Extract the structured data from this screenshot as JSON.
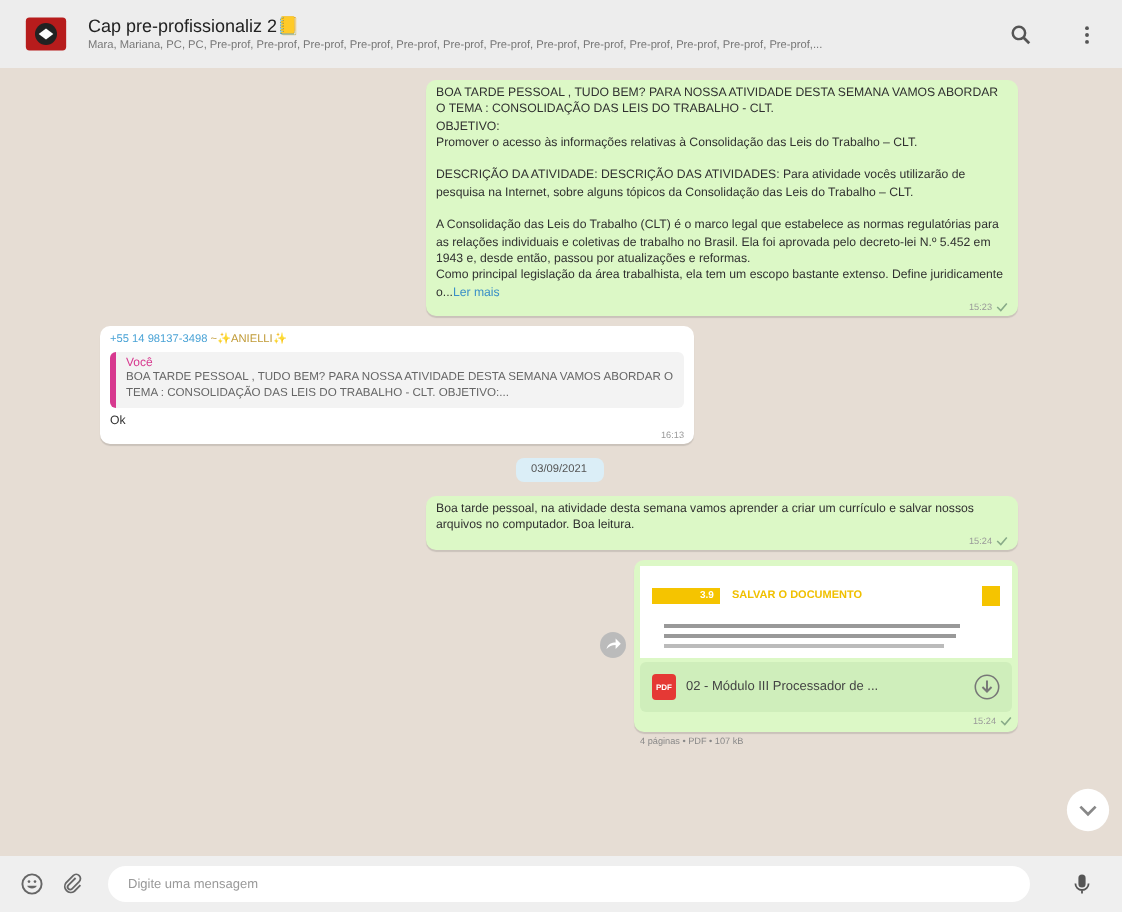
{
  "header": {
    "title": "Cap pre-profissionaliz 2",
    "title_emoji": "📒",
    "members": "Mara, Mariana, PC, PC, Pre-prof, Pre-prof, Pre-prof, Pre-prof, Pre-prof, Pre-prof, Pre-prof, Pre-prof, Pre-prof, Pre-prof, Pre-prof, Pre-prof, Pre-prof,..."
  },
  "messages": [
    {
      "kind": "text",
      "outgoing": true,
      "text": "BOA TARDE PESSOAL , TUDO BEM? PARA NOSSA ATIVIDADE DESTA SEMANA VAMOS ABORDAR O TEMA : CONSOLIDAÇÃO DAS LEIS DO TRABALHO - CLT.\nOBJETIVO:\nPromover o acesso às informações relativas à Consolidação das Leis do Trabalho – CLT.\n\nDESCRIÇÃO DA ATIVIDADE: DESCRIÇÃO DAS ATIVIDADES: Para atividade vocês utilizarão de pesquisa na Internet, sobre alguns tópicos da Consolidação das Leis do Trabalho – CLT.\n\n A Consolidação das Leis do Trabalho (CLT) é o marco legal que estabelece as normas regulatórias para as relações individuais e coletivas de trabalho no Brasil. Ela foi aprovada pelo decreto-lei N.º 5.452 em 1943 e, desde então, passou por atualizações e reformas.\nComo principal legislação da área trabalhista, ela tem um escopo bastante extenso. Define juridicamente o...",
      "read_more": "Ler mais",
      "time": "15:23"
    },
    {
      "kind": "reply",
      "outgoing": false,
      "sender_phone": "+55 14 98137-3498",
      "sender_name": "~✨ANIELLI✨",
      "quote_author": "Você",
      "quote_text": "BOA TARDE PESSOAL , TUDO BEM? PARA NOSSA ATIVIDADE DESTA SEMANA VAMOS ABORDAR O TEMA : CONSOLIDAÇÃO DAS LEIS DO TRABALHO - CLT. OBJETIVO:...",
      "text": "Ok",
      "time": "16:13"
    },
    {
      "kind": "date",
      "text": "03/09/2021"
    },
    {
      "kind": "text",
      "outgoing": true,
      "text": "Boa tarde pessoal, na atividade desta semana vamos aprender a criar um currículo e salvar nossos arquivos no computador. Boa leitura.",
      "time": "15:24"
    },
    {
      "kind": "document",
      "outgoing": true,
      "preview_number": "3.9",
      "preview_heading": "SALVAR O DOCUMENTO",
      "file_type": "PDF",
      "file_name": "02 - Módulo III Processador de ...",
      "meta": "4 páginas • PDF • 107 kB",
      "time": "15:24"
    }
  ],
  "composer": {
    "placeholder": "Digite uma mensagem"
  }
}
